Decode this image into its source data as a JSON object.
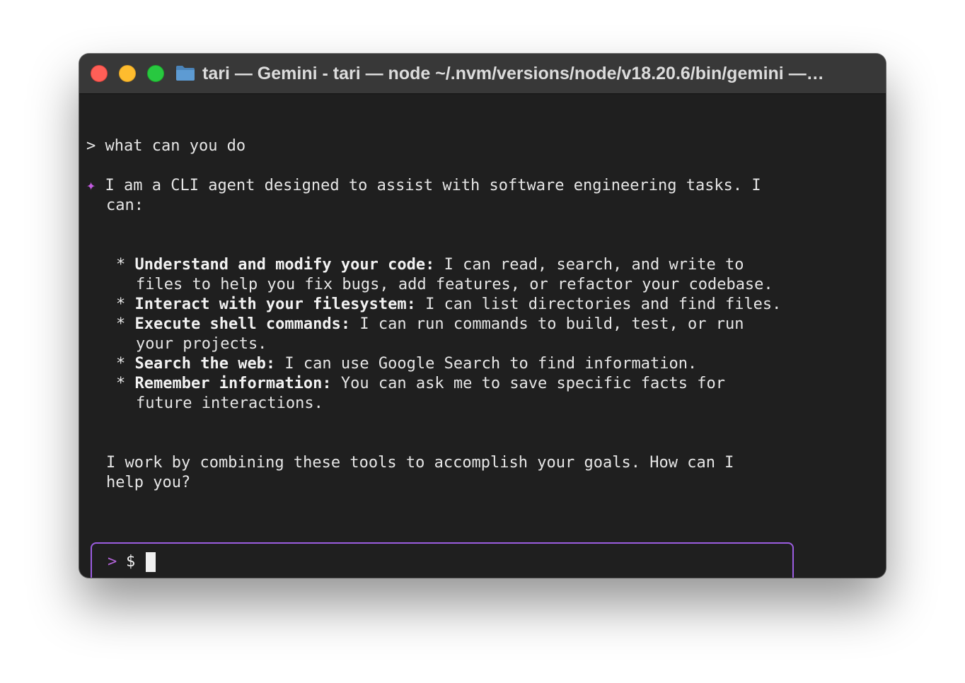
{
  "window": {
    "title": "tari —  Gemini - tari  — node ~/.nvm/versions/node/v18.20.6/bin/gemini —…"
  },
  "icons": {
    "close": "close-icon",
    "minimize": "minimize-icon",
    "zoom": "zoom-icon",
    "folder": "folder-icon",
    "sparkle": "sparkle-icon"
  },
  "colors": {
    "close": "#ff5f57",
    "minimize": "#febc2e",
    "zoom": "#28c840",
    "accent_purple": "#9b5de0",
    "background": "#1f1f1f"
  },
  "conversation": {
    "user_prompt_symbol": ">",
    "user_query": "what can you do",
    "agent_symbol": "✦",
    "intro_line1": "I am a CLI agent designed to assist with software engineering tasks. I",
    "intro_line2": "can:",
    "bullets": [
      {
        "marker": "*",
        "title": "Understand and modify your code:",
        "text1": " I can read, search, and write to",
        "text2": "files to help you fix bugs, add features, or refactor your codebase."
      },
      {
        "marker": "*",
        "title": "Interact with your filesystem:",
        "text1": " I can list directories and find files."
      },
      {
        "marker": "*",
        "title": "Execute shell commands:",
        "text1": " I can run commands to build, test, or run",
        "text2": "your projects."
      },
      {
        "marker": "*",
        "title": "Search the web:",
        "text1": " I can use Google Search to find information."
      },
      {
        "marker": "*",
        "title": "Remember information:",
        "text1": " You can ask me to save specific facts for",
        "text2": "future interactions."
      }
    ],
    "closing_line1": "I work by combining these tools to accomplish your goals. How can I",
    "closing_line2": "help you?"
  },
  "input": {
    "prompt_symbol": ">",
    "shell_symbol": "$",
    "value": ""
  }
}
